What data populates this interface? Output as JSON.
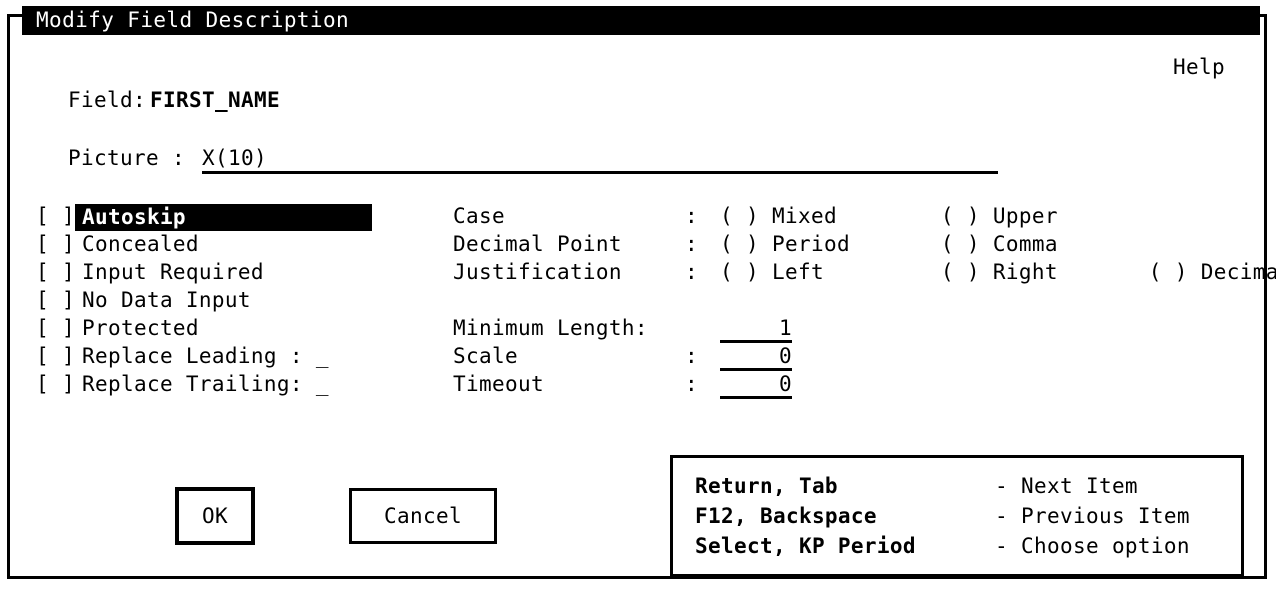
{
  "window": {
    "title": "Modify Field Description",
    "help_label": "Help"
  },
  "field": {
    "label": "Field:",
    "value": "FIRST_NAME"
  },
  "picture": {
    "label": "Picture :",
    "value": "X(10)"
  },
  "checkboxes": [
    {
      "box": "[ ]",
      "label": "Autoskip",
      "suffix": "",
      "selected": true
    },
    {
      "box": "[ ]",
      "label": "Concealed",
      "suffix": "",
      "selected": false
    },
    {
      "box": "[ ]",
      "label": "Input Required",
      "suffix": "",
      "selected": false
    },
    {
      "box": "[ ]",
      "label": "No Data Input",
      "suffix": "",
      "selected": false
    },
    {
      "box": "[ ]",
      "label": "Protected",
      "suffix": "",
      "selected": false
    },
    {
      "box": "[ ]",
      "label": "Replace Leading :",
      "suffix": " _",
      "selected": false
    },
    {
      "box": "[ ]",
      "label": "Replace Trailing:",
      "suffix": " _",
      "selected": false
    }
  ],
  "options": [
    {
      "name": "Case",
      "colon": ":",
      "choices": [
        {
          "marker": "( )",
          "label": "Mixed"
        },
        {
          "marker": "( )",
          "label": "Upper"
        }
      ]
    },
    {
      "name": "Decimal Point",
      "colon": ":",
      "choices": [
        {
          "marker": "( )",
          "label": "Period"
        },
        {
          "marker": "( )",
          "label": "Comma"
        }
      ]
    },
    {
      "name": "Justification",
      "colon": ":",
      "choices": [
        {
          "marker": "( )",
          "label": "Left"
        },
        {
          "marker": "( )",
          "label": "Right"
        },
        {
          "marker": "( )",
          "label": "Decimal"
        }
      ]
    }
  ],
  "values": [
    {
      "name": "Minimum Length:",
      "colon": "",
      "value": "1"
    },
    {
      "name": "Scale",
      "colon": ":",
      "value": "0"
    },
    {
      "name": "Timeout",
      "colon": ":",
      "value": "0"
    }
  ],
  "buttons": {
    "ok": "OK",
    "cancel": "Cancel"
  },
  "key_help": [
    {
      "combo": "Return, Tab",
      "desc": "- Next Item"
    },
    {
      "combo": "F12, Backspace",
      "desc": "- Previous Item"
    },
    {
      "combo": "Select, KP Period",
      "desc": "- Choose option"
    }
  ],
  "colors": {
    "foreground": "#000000",
    "background": "#ffffff",
    "highlight_bg": "#000000",
    "highlight_fg": "#ffffff"
  }
}
